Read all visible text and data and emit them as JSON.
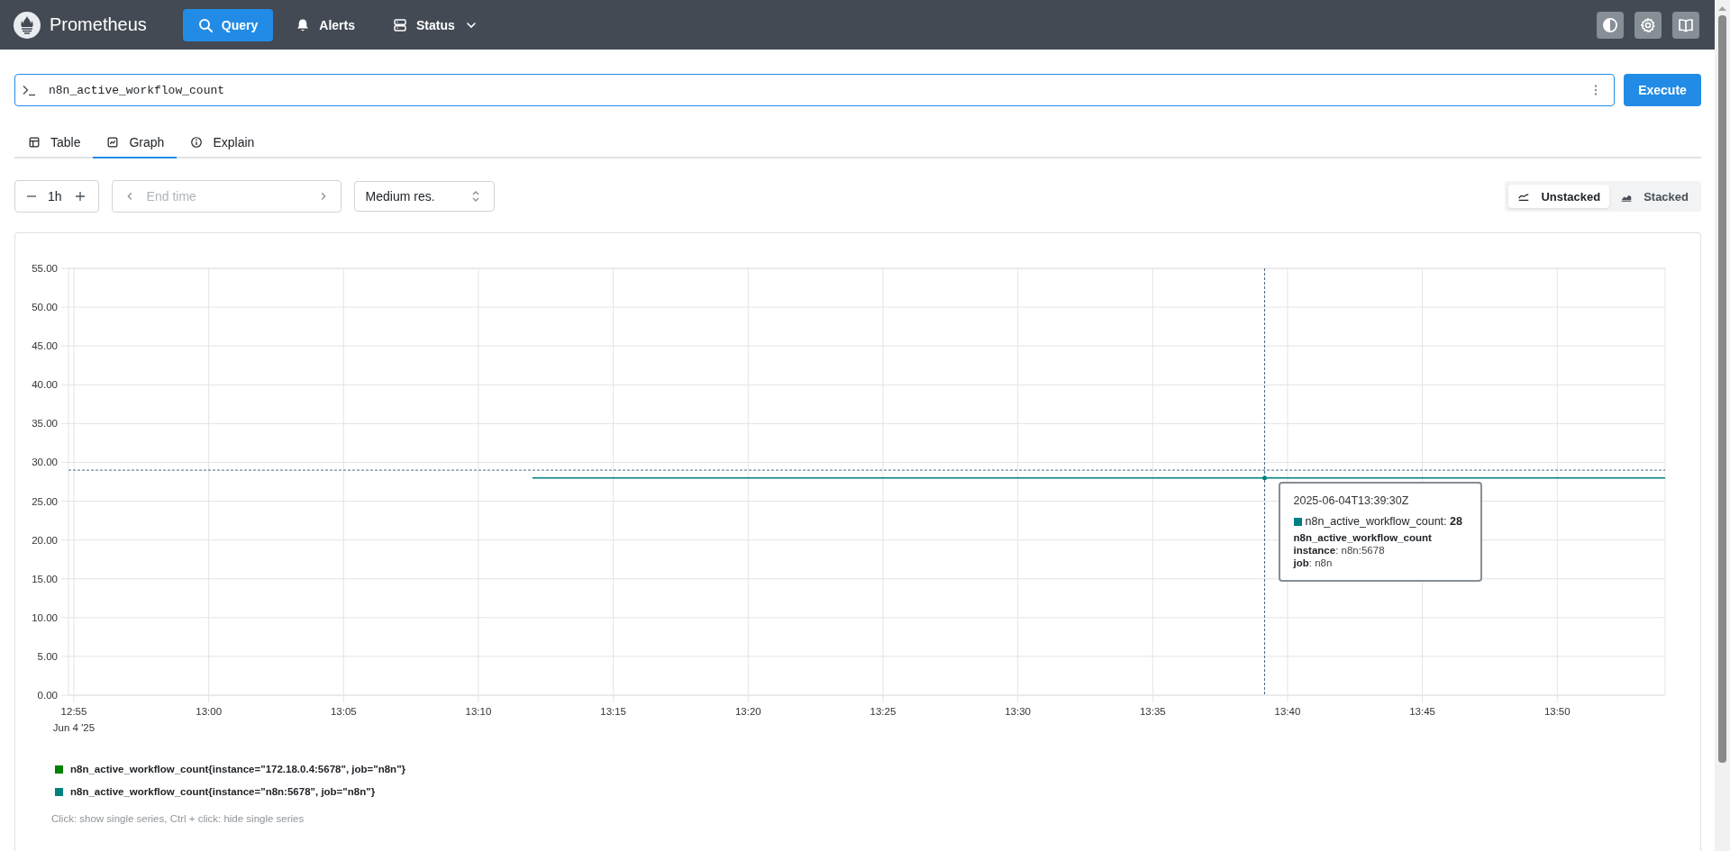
{
  "header": {
    "brand": "Prometheus",
    "nav": [
      {
        "label": "Query",
        "kind": "search",
        "selected": true,
        "dropdown": false
      },
      {
        "label": "Alerts",
        "kind": "bell",
        "selected": false,
        "dropdown": false
      },
      {
        "label": "Status",
        "kind": "server",
        "selected": false,
        "dropdown": true
      }
    ],
    "actions": [
      {
        "kind": "theme"
      },
      {
        "kind": "settings"
      },
      {
        "kind": "docs"
      }
    ]
  },
  "query": {
    "value": "n8n_active_workflow_count",
    "button": "Execute"
  },
  "tabs": [
    {
      "label": "Table",
      "kind": "table",
      "selected": false
    },
    {
      "label": "Graph",
      "kind": "graph",
      "selected": true
    },
    {
      "label": "Explain",
      "kind": "explain",
      "selected": false
    }
  ],
  "controls": {
    "range": "1h",
    "end_time_placeholder": "End time",
    "resolution": "Medium res.",
    "stack_modes": [
      {
        "label": "Unstacked",
        "kind": "unstacked",
        "selected": true
      },
      {
        "label": "Stacked",
        "kind": "stacked",
        "selected": false
      }
    ]
  },
  "graph": {
    "chart_data": {
      "type": "line",
      "categories": [
        "12:55",
        null,
        null,
        null,
        null,
        "13:00",
        null,
        null,
        null,
        null,
        "13:05",
        null,
        null,
        null,
        null,
        "13:10",
        null,
        null,
        null,
        null,
        "13:15",
        null,
        null,
        null,
        null,
        "13:20",
        null,
        null,
        null,
        null,
        "13:25",
        null,
        null,
        null,
        null,
        "13:30",
        null,
        null,
        null,
        null,
        "13:35",
        null,
        null,
        null,
        null,
        "13:40",
        null,
        null,
        null,
        null,
        "13:45",
        null,
        null,
        null,
        null,
        "13:50",
        null,
        null,
        null,
        null
      ],
      "series": [
        {
          "name": "n8n_active_workflow_count{instance=\"172.18.0.4:5678\", job=\"n8n\"}",
          "color": "#008000",
          "values": [
            null,
            null,
            null,
            null,
            null,
            null,
            null,
            null,
            null,
            null,
            null,
            null,
            null,
            null,
            null,
            null,
            null,
            null,
            null,
            null,
            null,
            null,
            null,
            null,
            null,
            null,
            null,
            null,
            null,
            null,
            null,
            null,
            null,
            null,
            null,
            null,
            null,
            null,
            null,
            null,
            null,
            null,
            null,
            null,
            null,
            null,
            null,
            null,
            null,
            null,
            null,
            null,
            null,
            null,
            null,
            null,
            null,
            null,
            null,
            null
          ]
        },
        {
          "name": "n8n_active_workflow_count{instance=\"n8n:5678\", job=\"n8n\"}",
          "color": "#008080",
          "values": [
            null,
            null,
            null,
            null,
            null,
            null,
            null,
            null,
            null,
            null,
            null,
            null,
            null,
            null,
            null,
            null,
            null,
            28,
            28,
            28,
            28,
            28,
            28,
            28,
            28,
            28,
            28,
            28,
            28,
            28,
            28,
            28,
            28,
            28,
            28,
            28,
            28,
            28,
            28,
            28,
            28,
            28,
            28,
            28,
            28,
            28,
            28,
            28,
            28,
            28,
            28,
            28,
            28,
            28,
            28,
            28,
            28,
            28,
            28,
            28
          ]
        }
      ],
      "ylim": [
        0,
        55
      ],
      "grid": true,
      "ref_lines": [
        {
          "axis": "y",
          "value": 29
        }
      ],
      "yticks": [
        {
          "value": 0,
          "label": "0.00"
        },
        {
          "value": 5,
          "label": "5.00"
        },
        {
          "value": 10,
          "label": "10.00"
        },
        {
          "value": 15,
          "label": "15.00"
        },
        {
          "value": 20,
          "label": "20.00"
        },
        {
          "value": 25,
          "label": "25.00"
        },
        {
          "value": 30,
          "label": "30.00"
        },
        {
          "value": 35,
          "label": "35.00"
        },
        {
          "value": 40,
          "label": "40.00"
        },
        {
          "value": 45,
          "label": "45.00"
        },
        {
          "value": 50,
          "label": "50.00"
        },
        {
          "value": 55,
          "label": "55.00"
        }
      ]
    },
    "date_label": "Jun 4 '25",
    "tooltip": {
      "time": "2025-06-04T13:39:30Z",
      "color": "#008080",
      "value_line": "n8n_active_workflow_count: **28**",
      "metric": "n8n_active_workflow_count",
      "labels": [
        "**instance**: n8n:5678",
        "**job**: n8n"
      ]
    },
    "hint": "Click: show single series, Ctrl + click: hide single series"
  }
}
